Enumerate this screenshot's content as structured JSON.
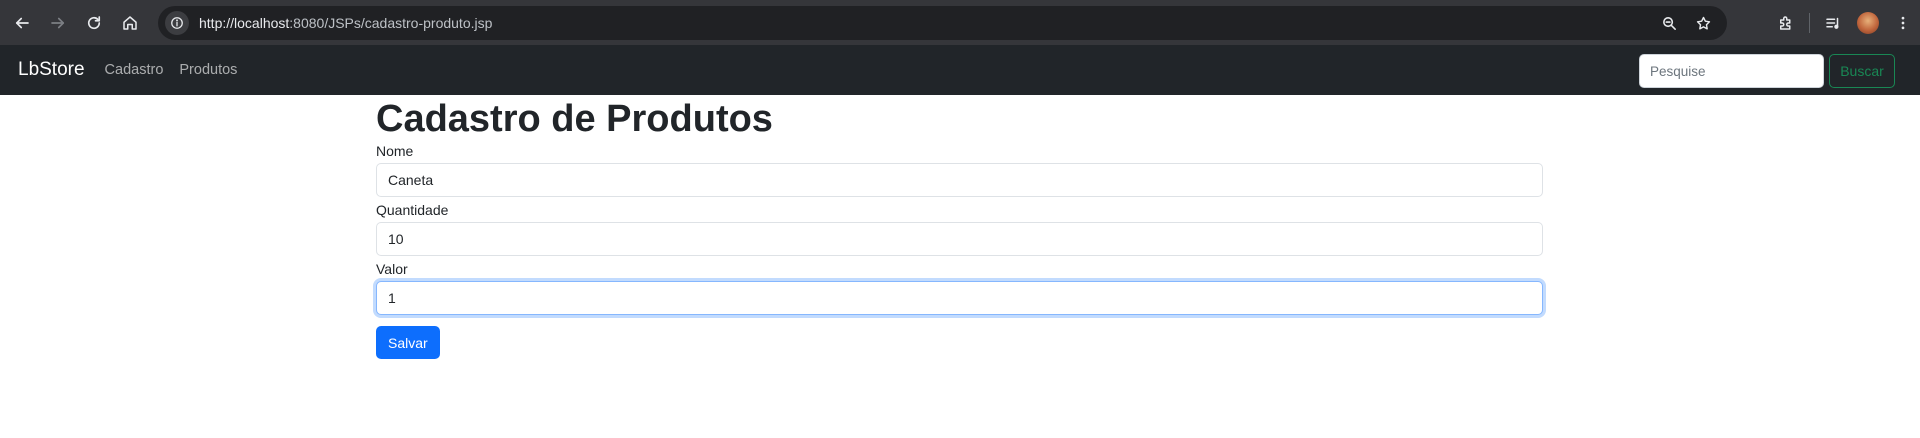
{
  "browser": {
    "url_host": "http://localhost",
    "url_rest": ":8080/JSPs/cadastro-produto.jsp",
    "icons": [
      "back-icon",
      "forward-icon",
      "reload-icon",
      "home-icon",
      "site-info-icon",
      "zoom-icon",
      "bookmark-star-icon",
      "extensions-icon",
      "media-queue-icon",
      "avatar",
      "kebab-menu-icon"
    ]
  },
  "navbar": {
    "brand": "LbStore",
    "links": [
      "Cadastro",
      "Produtos"
    ],
    "search_placeholder": "Pesquise",
    "search_button": "Buscar"
  },
  "form": {
    "title": "Cadastro de Produtos",
    "fields": [
      {
        "label": "Nome",
        "value": "Caneta"
      },
      {
        "label": "Quantidade",
        "value": "10"
      },
      {
        "label": "Valor",
        "value": "1"
      }
    ],
    "submit": "Salvar"
  },
  "colors": {
    "navbar_bg": "#212529",
    "primary": "#0d6efd",
    "success": "#198754",
    "chrome_bg": "#35363a"
  }
}
